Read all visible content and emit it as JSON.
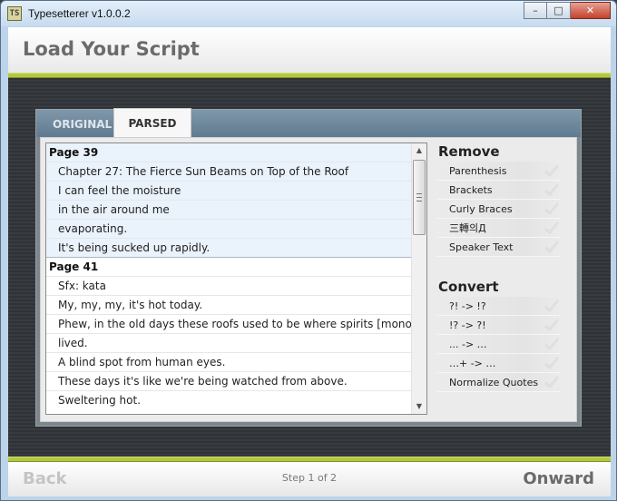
{
  "window": {
    "app_icon_text": "TS",
    "title": "Typesetterer v1.0.0.2",
    "controls": {
      "minimize": "–",
      "maximize": "□",
      "close": "✕"
    }
  },
  "header": {
    "title": "Load Your Script"
  },
  "tabs": [
    {
      "label": "ORIGINAL",
      "active": false
    },
    {
      "label": "PARSED",
      "active": true
    }
  ],
  "script": {
    "pages": [
      {
        "heading": "Page 39",
        "selected": true,
        "lines": [
          "Chapter 27: The Fierce Sun Beams on Top of the Roof",
          "I can feel the moisture",
          "in the air around me",
          "evaporating.",
          "It's being sucked up rapidly."
        ]
      },
      {
        "heading": "Page 41",
        "selected": false,
        "lines": [
          "Sfx: kata",
          "My, my, my, it's hot today.",
          "Phew, in the old days these roofs used to be where spirits [mononoke]",
          "lived.",
          "A blind spot from human eyes.",
          "These days it's like we're being watched from above.",
          "Sweltering hot."
        ]
      }
    ]
  },
  "options": {
    "remove": {
      "title": "Remove",
      "items": [
        "Parenthesis",
        "Brackets",
        "Curly Braces",
        "三轉의Д",
        "Speaker Text"
      ]
    },
    "convert": {
      "title": "Convert",
      "items": [
        "?! -> !?",
        "!? -> ?!",
        "... -> …",
        "…+ -> …",
        "Normalize Quotes"
      ]
    }
  },
  "footer": {
    "back_label": "Back",
    "step_text": "Step 1 of 2",
    "onward_label": "Onward"
  },
  "colors": {
    "accent_stripe": "#b2c83f",
    "tab_bar": "#6f889c",
    "selected_group": "#eaf2fb"
  }
}
